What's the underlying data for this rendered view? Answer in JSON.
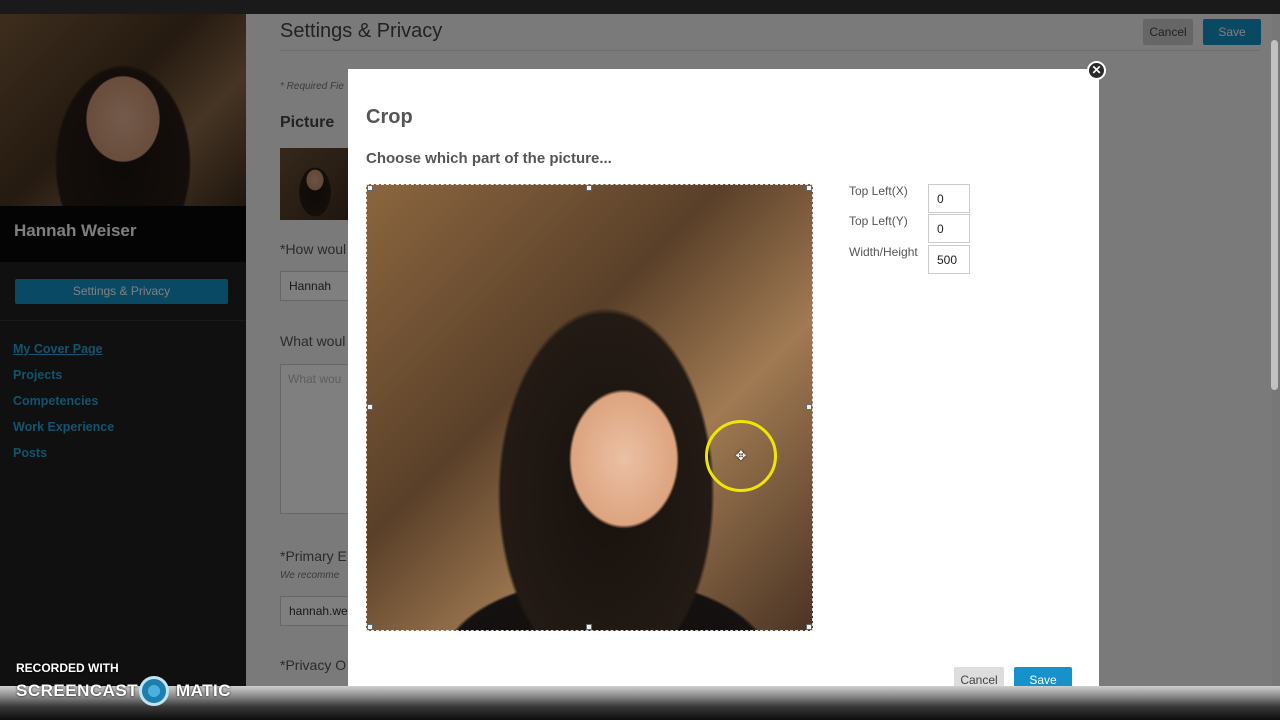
{
  "sidebar": {
    "profile_name": "Hannah Weiser",
    "settings_button": "Settings & Privacy",
    "nav": [
      {
        "label": "My Cover Page"
      },
      {
        "label": "Projects"
      },
      {
        "label": "Competencies"
      },
      {
        "label": "Work Experience"
      },
      {
        "label": "Posts"
      }
    ]
  },
  "main": {
    "title": "Settings & Privacy",
    "cancel_label": "Cancel",
    "save_label": "Save",
    "required_note": "* Required Fie",
    "picture_label": "Picture",
    "fields": {
      "name_label": "*How woul",
      "name_value": "Hannah",
      "about_label": "What woul",
      "about_placeholder": "What wou",
      "email_label": "*Primary E",
      "email_note": "We recomme",
      "email_value": "hannah.we",
      "privacy_label": "*Privacy O"
    }
  },
  "modal": {
    "title": "Crop",
    "instruction": "Choose which part of the picture...",
    "fields": [
      {
        "label": "Top Left(X)",
        "value": "0"
      },
      {
        "label": "Top Left(Y)",
        "value": "0"
      },
      {
        "label": "Width/Height",
        "value": "500"
      }
    ],
    "cancel_label": "Cancel",
    "save_label": "Save",
    "close_glyph": "✕"
  },
  "watermark": {
    "line1": "RECORDED WITH",
    "line2a": "SCREENCAST",
    "line2b": "MATIC"
  },
  "colors": {
    "accent": "#1592c9",
    "link": "#27a6dc",
    "sidebar_bg": "#202020"
  }
}
